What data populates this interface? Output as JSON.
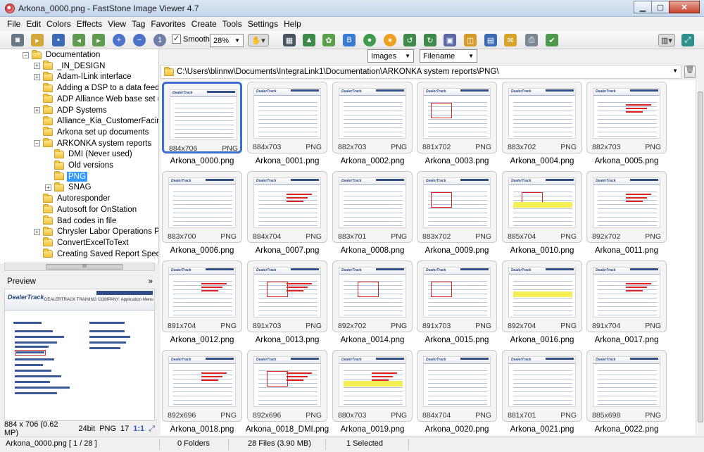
{
  "window": {
    "title": "Arkona_0000.png  -  FastStone Image Viewer 4.7"
  },
  "menu": [
    "File",
    "Edit",
    "Colors",
    "Effects",
    "View",
    "Tag",
    "Favorites",
    "Create",
    "Tools",
    "Settings",
    "Help"
  ],
  "toolbar": {
    "smooth_label": "Smooth",
    "smooth_checked": "✓",
    "zoom_value": "28%"
  },
  "tree": [
    {
      "label": "Documentation",
      "level": 0,
      "expander": "−"
    },
    {
      "label": "_IN_DESIGN",
      "level": 1,
      "expander": "+"
    },
    {
      "label": "Adam-ILink interface",
      "level": 1,
      "expander": "+"
    },
    {
      "label": "Adding a DSP to a data feed",
      "level": 1,
      "expander": ""
    },
    {
      "label": "ADP Alliance Web base set u",
      "level": 1,
      "expander": ""
    },
    {
      "label": "ADP Systems",
      "level": 1,
      "expander": "+"
    },
    {
      "label": "Alliance_Kia_CustomerFacin",
      "level": 1,
      "expander": ""
    },
    {
      "label": "Arkona set up documents",
      "level": 1,
      "expander": ""
    },
    {
      "label": "ARKONKA system reports",
      "level": 1,
      "expander": "−"
    },
    {
      "label": "DMI (Never used)",
      "level": 2,
      "expander": ""
    },
    {
      "label": "Old versions",
      "level": 2,
      "expander": ""
    },
    {
      "label": "PNG",
      "level": 2,
      "expander": "",
      "selected": true
    },
    {
      "label": "SNAG",
      "level": 2,
      "expander": "+"
    },
    {
      "label": "Autoresponder",
      "level": 1,
      "expander": ""
    },
    {
      "label": "Autosoft for OnStation",
      "level": 1,
      "expander": ""
    },
    {
      "label": "Bad codes in file",
      "level": 1,
      "expander": ""
    },
    {
      "label": "Chrysler Labor Operations P",
      "level": 1,
      "expander": "+"
    },
    {
      "label": "ConvertExcelToText",
      "level": 1,
      "expander": ""
    },
    {
      "label": "Creating Saved Report Spec",
      "level": 1,
      "expander": ""
    }
  ],
  "hscroll_grip": "III",
  "preview": {
    "title": "Preview",
    "collapse_icon": "»",
    "logo": "DealerTrack",
    "subtitle": "DEALERTRACK TRAINING COMPANY: Application Menu"
  },
  "left_status": {
    "dims": "884 x 706 (0.62 MP)",
    "depth": "24bit",
    "format": "PNG",
    "num": "17",
    "ratio": "1:1"
  },
  "filters": {
    "type": "Images",
    "sort": "Filename"
  },
  "path": "C:\\Users\\blinnw\\Documents\\IntegraLink1\\Documentation\\ARKONKA system reports\\PNG\\",
  "thumbnails": [
    {
      "name": "Arkona_0000.png",
      "dims": "884x706",
      "fmt": "PNG"
    },
    {
      "name": "Arkona_0001.png",
      "dims": "884x703",
      "fmt": "PNG"
    },
    {
      "name": "Arkona_0002.png",
      "dims": "882x703",
      "fmt": "PNG"
    },
    {
      "name": "Arkona_0003.png",
      "dims": "881x702",
      "fmt": "PNG"
    },
    {
      "name": "Arkona_0004.png",
      "dims": "883x702",
      "fmt": "PNG"
    },
    {
      "name": "Arkona_0005.png",
      "dims": "882x703",
      "fmt": "PNG"
    },
    {
      "name": "Arkona_0006.png",
      "dims": "883x700",
      "fmt": "PNG"
    },
    {
      "name": "Arkona_0007.png",
      "dims": "884x704",
      "fmt": "PNG"
    },
    {
      "name": "Arkona_0008.png",
      "dims": "883x701",
      "fmt": "PNG"
    },
    {
      "name": "Arkona_0009.png",
      "dims": "883x702",
      "fmt": "PNG"
    },
    {
      "name": "Arkona_0010.png",
      "dims": "885x704",
      "fmt": "PNG"
    },
    {
      "name": "Arkona_0011.png",
      "dims": "892x702",
      "fmt": "PNG"
    },
    {
      "name": "Arkona_0012.png",
      "dims": "891x704",
      "fmt": "PNG"
    },
    {
      "name": "Arkona_0013.png",
      "dims": "891x703",
      "fmt": "PNG"
    },
    {
      "name": "Arkona_0014.png",
      "dims": "892x702",
      "fmt": "PNG"
    },
    {
      "name": "Arkona_0015.png",
      "dims": "891x703",
      "fmt": "PNG"
    },
    {
      "name": "Arkona_0016.png",
      "dims": "892x704",
      "fmt": "PNG"
    },
    {
      "name": "Arkona_0017.png",
      "dims": "891x704",
      "fmt": "PNG"
    },
    {
      "name": "Arkona_0018.png",
      "dims": "892x696",
      "fmt": "PNG"
    },
    {
      "name": "Arkona_0018_DMI.png",
      "dims": "892x696",
      "fmt": "PNG"
    },
    {
      "name": "Arkona_0019.png",
      "dims": "880x703",
      "fmt": "PNG"
    },
    {
      "name": "Arkona_0020.png",
      "dims": "884x704",
      "fmt": "PNG"
    },
    {
      "name": "Arkona_0021.png",
      "dims": "881x701",
      "fmt": "PNG"
    },
    {
      "name": "Arkona_0022.png",
      "dims": "885x698",
      "fmt": "PNG"
    }
  ],
  "status": {
    "file": "Arkona_0000.png [ 1 / 28 ]",
    "folders": "0 Folders",
    "files": "28 Files (3.90 MB)",
    "selected": "1 Selected"
  }
}
